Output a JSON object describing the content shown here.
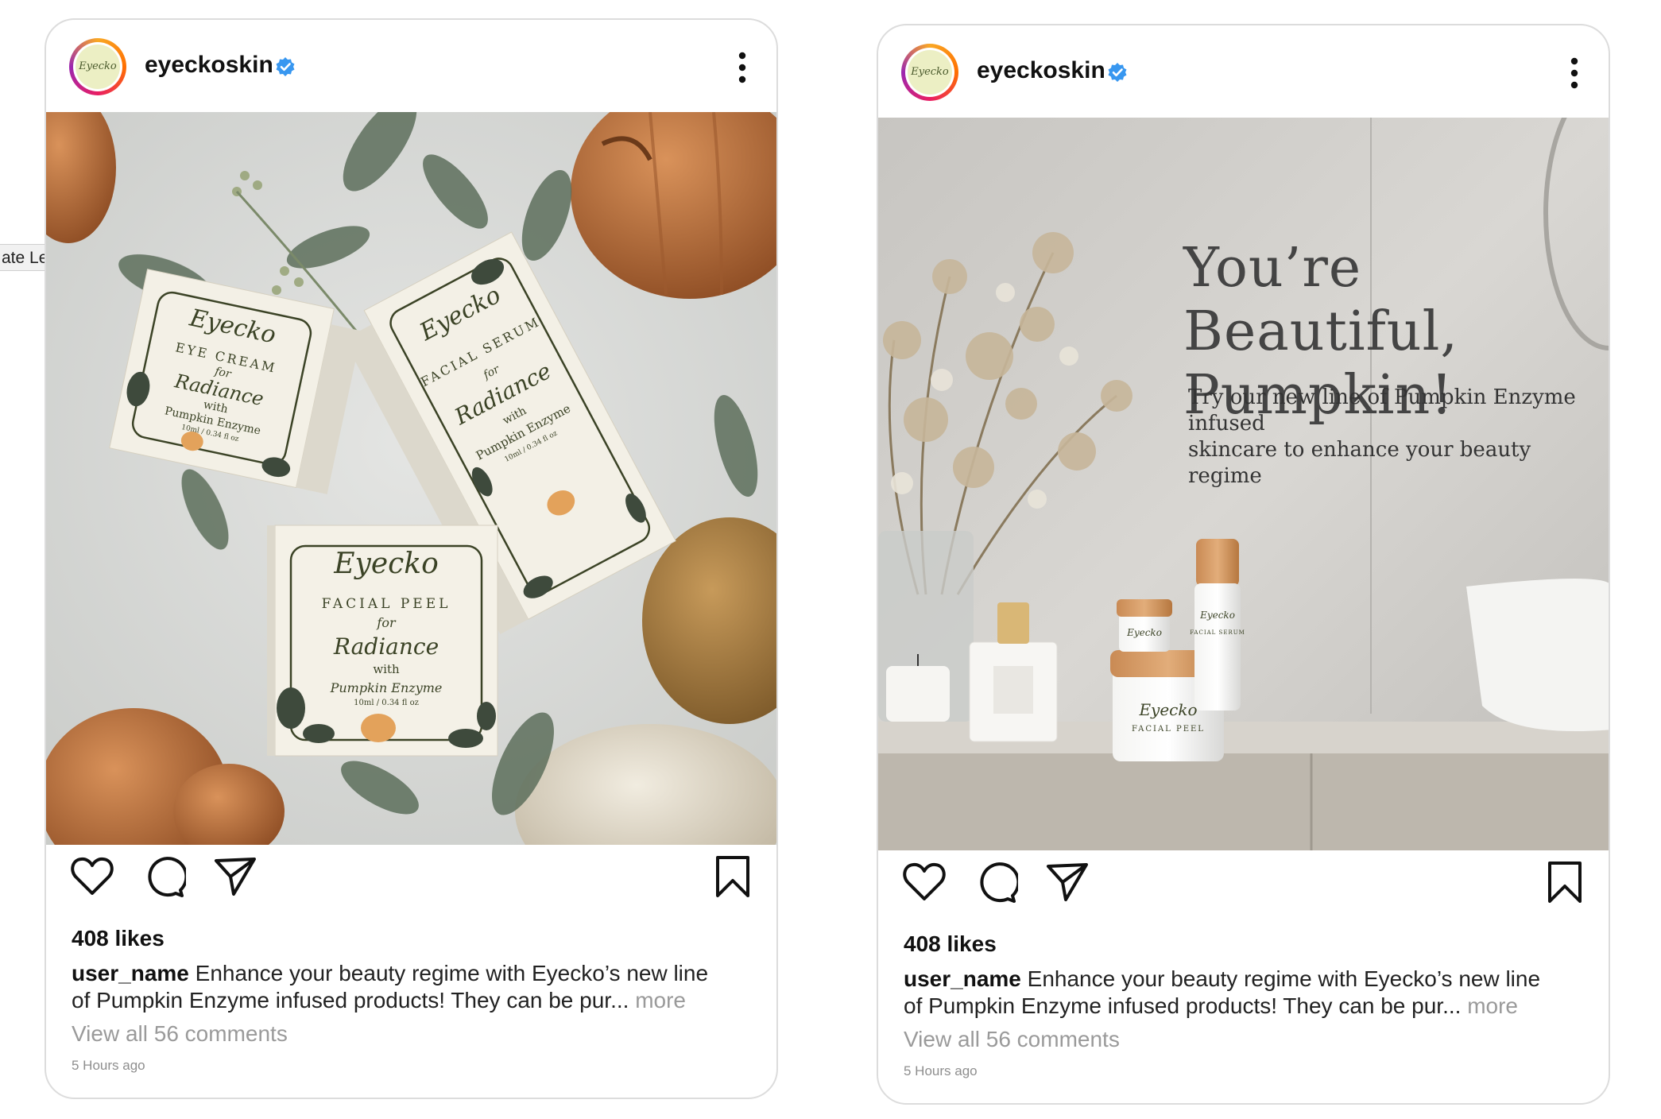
{
  "tooltip": {
    "label": "ate Left"
  },
  "posts": [
    {
      "account": {
        "username": "eyeckoskin",
        "avatar_text": "Eyecko"
      },
      "image": {
        "products": [
          {
            "brand": "Eyecko",
            "line1": "EYE CREAM",
            "line2": "for",
            "line3": "Radiance",
            "line4": "with",
            "line5": "Pumpkin Enzyme",
            "size": "10ml / 0.34 fl oz"
          },
          {
            "brand": "Eyecko",
            "line1": "FACIAL SERUM",
            "line2": "for",
            "line3": "Radiance",
            "line4": "with",
            "line5": "Pumpkin Enzyme",
            "size": "10ml / 0.34 fl oz"
          },
          {
            "brand": "Eyecko",
            "line1": "FACIAL PEEL",
            "line2": "for",
            "line3": "Radiance",
            "line4": "with",
            "line5": "Pumpkin Enzyme",
            "size": "10ml / 0.34 fl oz"
          }
        ]
      },
      "likes": "408 likes",
      "caption_user": "user_name",
      "caption_text": "Enhance your beauty regime with Eyecko’s new line of Pumpkin Enzyme infused products!  They can be pur...",
      "caption_more": "more",
      "comments": "View all 56 comments",
      "time": "5 Hours ago"
    },
    {
      "account": {
        "username": "eyeckoskin",
        "avatar_text": "Eyecko"
      },
      "image": {
        "headline_line1": "You’re Beautiful,",
        "headline_line2": "Pumpkin!",
        "subline_line1": "Try our new line of Pumpkin Enzyme infused",
        "subline_line2": "skincare to enhance your beauty regime",
        "jar_label": "Eyecko",
        "jar_sub": "FACIAL PEEL",
        "serum_label": "Eyecko",
        "serum_sub": "FACIAL SERUM",
        "small_jar_label": "Eyecko"
      },
      "likes": "408 likes",
      "caption_user": "user_name",
      "caption_text": "Enhance your beauty regime with Eyecko’s new line of Pumpkin Enzyme infused products!  They can be pur...",
      "caption_more": "more",
      "comments": "View all 56 comments",
      "time": "5 Hours ago"
    }
  ],
  "icons": {
    "verified": "verified-badge-icon",
    "more": "more-options-icon",
    "like": "heart-icon",
    "comment": "comment-icon",
    "share": "send-icon",
    "save": "bookmark-icon"
  },
  "colors": {
    "verified": "#3897f0",
    "muted": "#9a9a9a",
    "border": "#dcdcdc"
  }
}
